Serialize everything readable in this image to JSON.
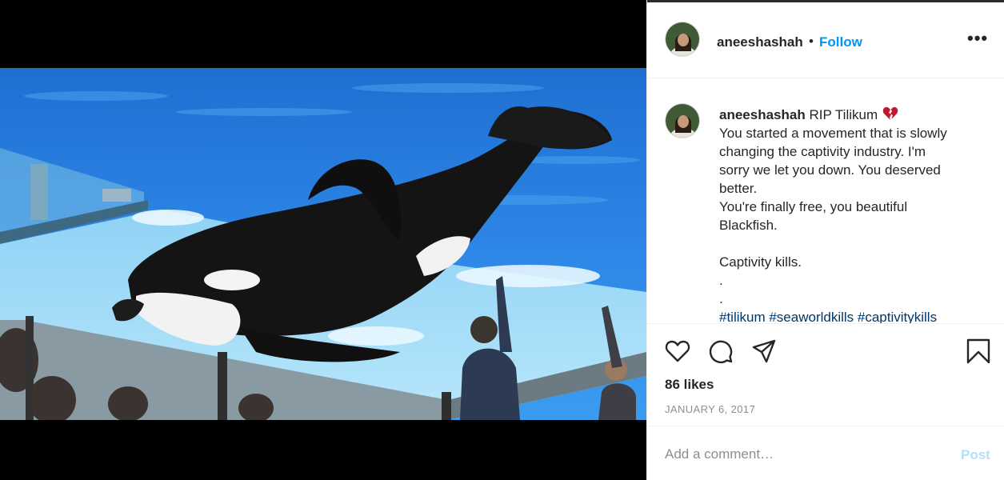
{
  "post": {
    "media_alt": "Orca whale resting on a pool slide-out",
    "header": {
      "username": "aneeshashah",
      "separator": "•",
      "follow_label": "Follow",
      "more_label": "•••"
    },
    "caption": {
      "username": "aneeshashah",
      "first_line": "RIP Tilikum",
      "lines": [
        "You started a movement that is slowly",
        "changing the captivity industry. I'm",
        "sorry we let you down. You deserved",
        "better.",
        "You're finally free, you beautiful",
        "Blackfish."
      ],
      "line_after_gap": "Captivity kills.",
      "dots": [
        ".",
        "."
      ],
      "hashtags": "#tilikum #seaworldkills #captivitykills"
    },
    "actions": {
      "icons": [
        "heart-icon",
        "comment-icon",
        "share-icon",
        "bookmark-icon"
      ]
    },
    "likes": "86 likes",
    "date": "JANUARY 6, 2017",
    "comment_box": {
      "placeholder": "Add a comment…",
      "post_label": "Post"
    }
  },
  "colors": {
    "link_blue": "#0095f6",
    "hashtag_blue": "#00376b",
    "muted": "#8e8e8e",
    "post_disabled": "#b2dffc",
    "emoji_red": "#be1931"
  }
}
